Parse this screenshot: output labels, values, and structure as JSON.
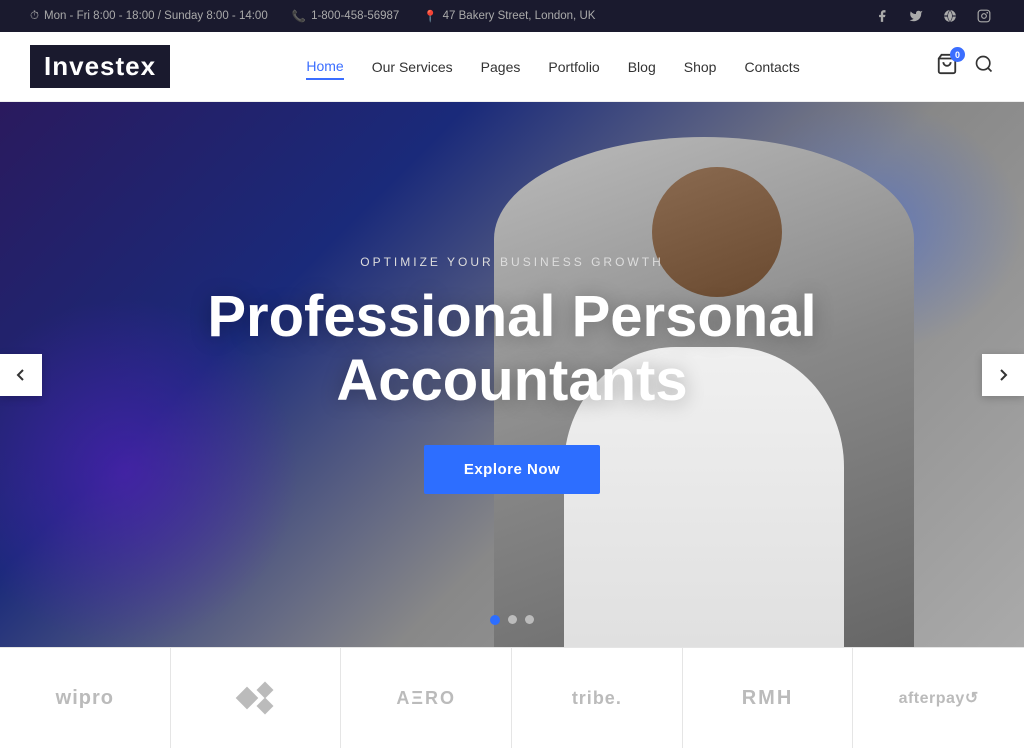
{
  "topbar": {
    "hours": "Mon - Fri 8:00 - 18:00 / Sunday 8:00 - 14:00",
    "phone": "1-800-458-56987",
    "address": "47 Bakery Street, London, UK"
  },
  "header": {
    "logo": "Investex",
    "nav": [
      {
        "label": "Home",
        "active": true
      },
      {
        "label": "Our Services",
        "active": false
      },
      {
        "label": "Pages",
        "active": false
      },
      {
        "label": "Portfolio",
        "active": false
      },
      {
        "label": "Blog",
        "active": false
      },
      {
        "label": "Shop",
        "active": false
      },
      {
        "label": "Contacts",
        "active": false
      }
    ],
    "cart_badge": "0"
  },
  "hero": {
    "subtitle": "Optimize Your Business Growth",
    "title": "Professional Personal Accountants",
    "cta_label": "Explore Now",
    "dots": [
      {
        "active": true
      },
      {
        "active": false
      },
      {
        "active": false
      }
    ]
  },
  "partners": [
    {
      "name": "wipro",
      "display": "wipro"
    },
    {
      "name": "diamonds",
      "display": "◆◆◆"
    },
    {
      "name": "aero",
      "display": "AΞRO"
    },
    {
      "name": "tribe",
      "display": "tribe."
    },
    {
      "name": "rmh",
      "display": "RMH"
    },
    {
      "name": "afterpay",
      "display": "afterpay⟳"
    }
  ]
}
